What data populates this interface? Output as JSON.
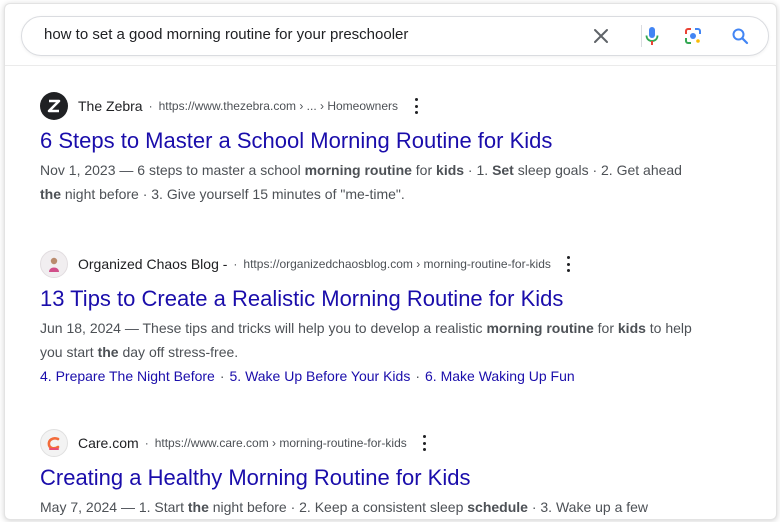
{
  "search": {
    "query": "how to set a good morning routine for your preschooler"
  },
  "results": [
    {
      "site_name": "The Zebra",
      "url": "https://www.thezebra.com › ... › Homeowners",
      "title": "6 Steps to Master a School Morning Routine for Kids",
      "snippet_lines": [
        [
          {
            "t": "Nov 1, 2023 — 6 steps to master a school ",
            "b": false
          },
          {
            "t": "morning routine",
            "b": true
          },
          {
            "t": " for ",
            "b": false
          },
          {
            "t": "kids",
            "b": true
          },
          {
            "t": " · 1. ",
            "b": false
          },
          {
            "t": "Set",
            "b": true
          },
          {
            "t": " sleep goals · 2. Get ahead",
            "b": false
          }
        ],
        [
          {
            "t": "the",
            "b": true
          },
          {
            "t": " night before · 3. Give yourself 15 minutes of \"me-time\".",
            "b": false
          }
        ]
      ]
    },
    {
      "site_name": "Organized Chaos Blog -",
      "url": "https://organizedchaosblog.com › morning-routine-for-kids",
      "title": "13 Tips to Create a Realistic Morning Routine for Kids",
      "snippet_lines": [
        [
          {
            "t": "Jun 18, 2024 — These tips and tricks will help you to develop a realistic ",
            "b": false
          },
          {
            "t": "morning routine",
            "b": true
          },
          {
            "t": " for ",
            "b": false
          },
          {
            "t": "kids",
            "b": true
          },
          {
            "t": " to help",
            "b": false
          }
        ],
        [
          {
            "t": "you start ",
            "b": false
          },
          {
            "t": "the",
            "b": true
          },
          {
            "t": " day off stress-free.",
            "b": false
          }
        ]
      ],
      "sitelinks": [
        "4. Prepare The Night Before",
        "5. Wake Up Before Your Kids",
        "6. Make Waking Up Fun"
      ]
    },
    {
      "site_name": "Care.com",
      "url": "https://www.care.com › morning-routine-for-kids",
      "title": "Creating a Healthy Morning Routine for Kids",
      "snippet_lines": [
        [
          {
            "t": "May 7, 2024 — 1. Start ",
            "b": false
          },
          {
            "t": "the",
            "b": true
          },
          {
            "t": " night before · 2. Keep a consistent sleep ",
            "b": false
          },
          {
            "t": "schedule",
            "b": true
          },
          {
            "t": " · 3. Wake up a few",
            "b": false
          }
        ]
      ]
    }
  ],
  "colors": {
    "title_link": "#1a0dab",
    "snippet_text": "#4d5156",
    "mic_blue": "#4285f4",
    "mic_red": "#ea4335"
  },
  "icons": [
    "clear-icon",
    "microphone-icon",
    "lens-icon",
    "search-icon",
    "more-options-icon"
  ]
}
